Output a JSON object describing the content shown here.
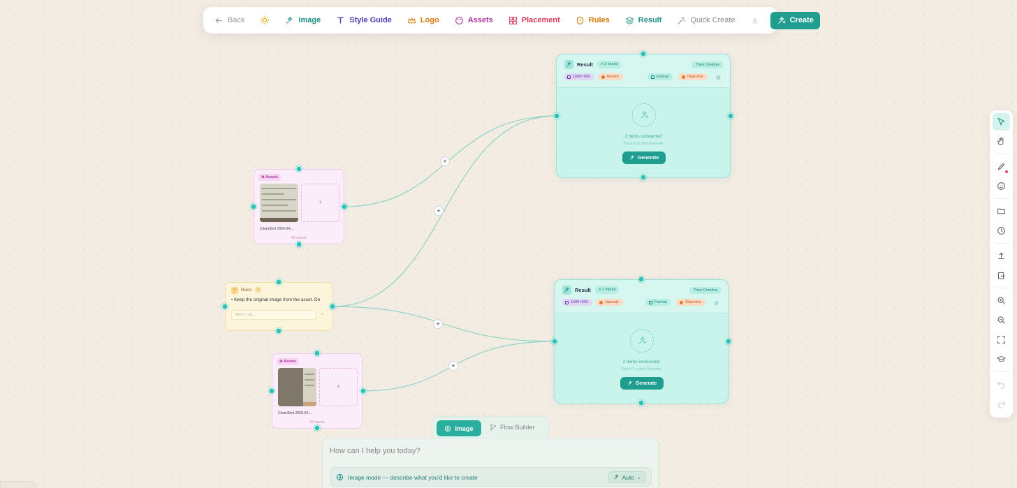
{
  "toolbar": {
    "back": "Back",
    "items": [
      {
        "label": "Image",
        "color": "#1f8f85",
        "icon": "sparkle-icon"
      },
      {
        "label": "Style Guide",
        "color": "#4b3fb5",
        "icon": "text-icon"
      },
      {
        "label": "Logo",
        "color": "#d4780a",
        "icon": "crown-icon"
      },
      {
        "label": "Assets",
        "color": "#b3359f",
        "icon": "palette-icon"
      },
      {
        "label": "Placement",
        "color": "#d83a5a",
        "icon": "grid-icon"
      },
      {
        "label": "Rules",
        "color": "#d4780a",
        "icon": "shield-icon"
      },
      {
        "label": "Result",
        "color": "#1f8f85",
        "icon": "layers-icon"
      }
    ],
    "quick_create": "Quick Create",
    "create": "Create"
  },
  "results": [
    {
      "title": "Result",
      "inputs": "2 inputs",
      "brand": "Theo Creative",
      "size": "1600×900",
      "mode": "Resize",
      "format": "Format",
      "objective": "Objective",
      "connected": "2 items connected",
      "hint": "Press G or click Generate",
      "generate": "Generate"
    },
    {
      "title": "Result",
      "inputs": "2 inputs",
      "brand": "Theo Creative",
      "size": "1600×900",
      "mode": "Upscale",
      "format": "Format",
      "objective": "Objective",
      "connected": "2 items connected",
      "hint": "Press G or click Generate",
      "generate": "Generate"
    }
  ],
  "assets": [
    {
      "tag": "Assets",
      "filename": "CleanShot 2026-04-...",
      "count": "58 assets"
    },
    {
      "tag": "Assets",
      "filename": "CleanShot 2026-04-...",
      "count": "58 assets"
    }
  ],
  "rules": {
    "title": "Rules",
    "count": "1",
    "rule": "Keep the original image from the asset. Do",
    "placeholder": "Add a rule..."
  },
  "modes": {
    "image": "Image",
    "flow": "Flow Builder"
  },
  "chat": {
    "placeholder": "How can I help you today?",
    "mode_text": "Image mode — describe what you'd like to create",
    "auto": "Auto"
  },
  "colors": {
    "accent": "#1f9e8f",
    "node_result": "#c9f4ec",
    "node_assets": "#fbeefa",
    "node_rules": "#fdf4dc"
  }
}
